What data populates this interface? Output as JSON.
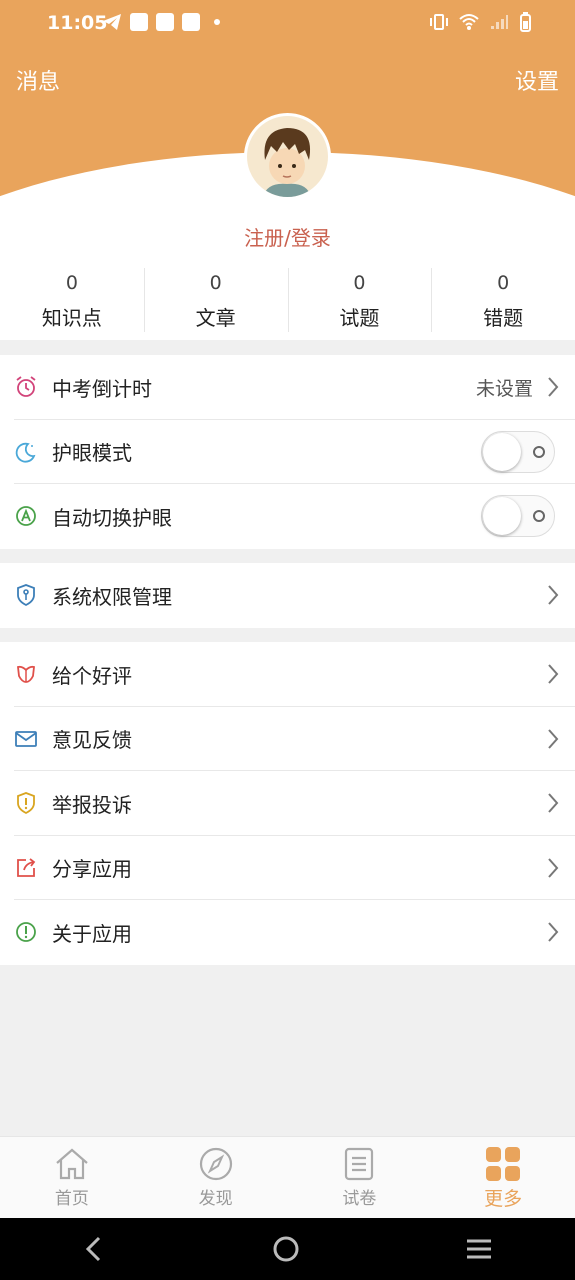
{
  "status_bar": {
    "time": "11:05"
  },
  "header": {
    "left_link": "消息",
    "right_link": "设置",
    "login_text": "注册/登录"
  },
  "stats": [
    {
      "value": "0",
      "label": "知识点"
    },
    {
      "value": "0",
      "label": "文章"
    },
    {
      "value": "0",
      "label": "试题"
    },
    {
      "value": "0",
      "label": "错题"
    }
  ],
  "settings": {
    "countdown": {
      "label": "中考倒计时",
      "value": "未设置",
      "icon": "alarm-clock-icon"
    },
    "eye_mode": {
      "label": "护眼模式",
      "enabled": false,
      "icon": "moon-icon"
    },
    "auto_eye": {
      "label": "自动切换护眼",
      "enabled": false,
      "icon": "auto-switch-icon"
    }
  },
  "permissions": {
    "label": "系统权限管理",
    "icon": "shield-key-icon"
  },
  "more_items": [
    {
      "label": "给个好评",
      "icon": "flower-icon"
    },
    {
      "label": "意见反馈",
      "icon": "envelope-icon"
    },
    {
      "label": "举报投诉",
      "icon": "report-shield-icon"
    },
    {
      "label": "分享应用",
      "icon": "share-icon"
    },
    {
      "label": "关于应用",
      "icon": "info-circle-icon"
    }
  ],
  "tabbar": [
    {
      "label": "首页",
      "icon": "home-icon"
    },
    {
      "label": "发现",
      "icon": "compass-icon"
    },
    {
      "label": "试卷",
      "icon": "paper-icon"
    },
    {
      "label": "更多",
      "icon": "grid-icon",
      "active": true
    }
  ],
  "colors": {
    "accent": "#e9a45c",
    "login": "#c9614f"
  }
}
